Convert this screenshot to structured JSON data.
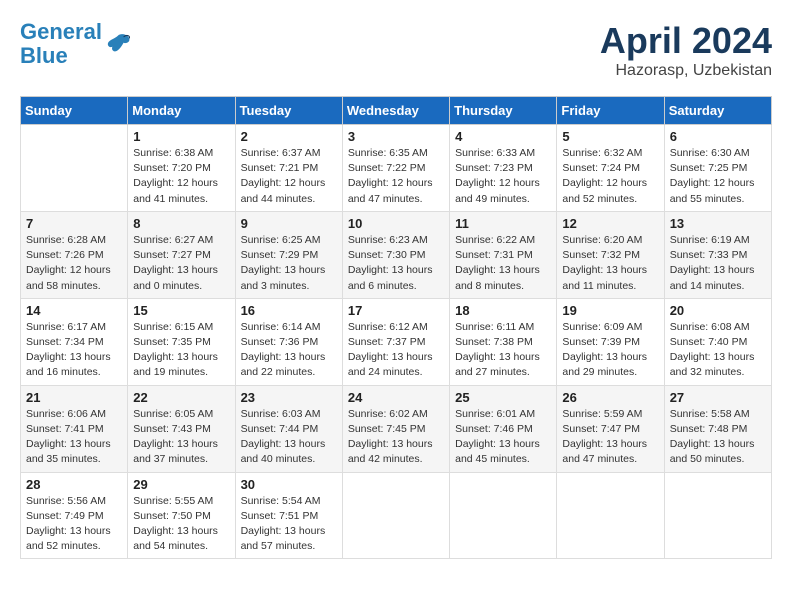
{
  "header": {
    "logo_line1": "General",
    "logo_line2": "Blue",
    "month": "April 2024",
    "location": "Hazorasp, Uzbekistan"
  },
  "days_of_week": [
    "Sunday",
    "Monday",
    "Tuesday",
    "Wednesday",
    "Thursday",
    "Friday",
    "Saturday"
  ],
  "weeks": [
    [
      {
        "day": "",
        "sunrise": "",
        "sunset": "",
        "daylight": ""
      },
      {
        "day": "1",
        "sunrise": "Sunrise: 6:38 AM",
        "sunset": "Sunset: 7:20 PM",
        "daylight": "Daylight: 12 hours and 41 minutes."
      },
      {
        "day": "2",
        "sunrise": "Sunrise: 6:37 AM",
        "sunset": "Sunset: 7:21 PM",
        "daylight": "Daylight: 12 hours and 44 minutes."
      },
      {
        "day": "3",
        "sunrise": "Sunrise: 6:35 AM",
        "sunset": "Sunset: 7:22 PM",
        "daylight": "Daylight: 12 hours and 47 minutes."
      },
      {
        "day": "4",
        "sunrise": "Sunrise: 6:33 AM",
        "sunset": "Sunset: 7:23 PM",
        "daylight": "Daylight: 12 hours and 49 minutes."
      },
      {
        "day": "5",
        "sunrise": "Sunrise: 6:32 AM",
        "sunset": "Sunset: 7:24 PM",
        "daylight": "Daylight: 12 hours and 52 minutes."
      },
      {
        "day": "6",
        "sunrise": "Sunrise: 6:30 AM",
        "sunset": "Sunset: 7:25 PM",
        "daylight": "Daylight: 12 hours and 55 minutes."
      }
    ],
    [
      {
        "day": "7",
        "sunrise": "Sunrise: 6:28 AM",
        "sunset": "Sunset: 7:26 PM",
        "daylight": "Daylight: 12 hours and 58 minutes."
      },
      {
        "day": "8",
        "sunrise": "Sunrise: 6:27 AM",
        "sunset": "Sunset: 7:27 PM",
        "daylight": "Daylight: 13 hours and 0 minutes."
      },
      {
        "day": "9",
        "sunrise": "Sunrise: 6:25 AM",
        "sunset": "Sunset: 7:29 PM",
        "daylight": "Daylight: 13 hours and 3 minutes."
      },
      {
        "day": "10",
        "sunrise": "Sunrise: 6:23 AM",
        "sunset": "Sunset: 7:30 PM",
        "daylight": "Daylight: 13 hours and 6 minutes."
      },
      {
        "day": "11",
        "sunrise": "Sunrise: 6:22 AM",
        "sunset": "Sunset: 7:31 PM",
        "daylight": "Daylight: 13 hours and 8 minutes."
      },
      {
        "day": "12",
        "sunrise": "Sunrise: 6:20 AM",
        "sunset": "Sunset: 7:32 PM",
        "daylight": "Daylight: 13 hours and 11 minutes."
      },
      {
        "day": "13",
        "sunrise": "Sunrise: 6:19 AM",
        "sunset": "Sunset: 7:33 PM",
        "daylight": "Daylight: 13 hours and 14 minutes."
      }
    ],
    [
      {
        "day": "14",
        "sunrise": "Sunrise: 6:17 AM",
        "sunset": "Sunset: 7:34 PM",
        "daylight": "Daylight: 13 hours and 16 minutes."
      },
      {
        "day": "15",
        "sunrise": "Sunrise: 6:15 AM",
        "sunset": "Sunset: 7:35 PM",
        "daylight": "Daylight: 13 hours and 19 minutes."
      },
      {
        "day": "16",
        "sunrise": "Sunrise: 6:14 AM",
        "sunset": "Sunset: 7:36 PM",
        "daylight": "Daylight: 13 hours and 22 minutes."
      },
      {
        "day": "17",
        "sunrise": "Sunrise: 6:12 AM",
        "sunset": "Sunset: 7:37 PM",
        "daylight": "Daylight: 13 hours and 24 minutes."
      },
      {
        "day": "18",
        "sunrise": "Sunrise: 6:11 AM",
        "sunset": "Sunset: 7:38 PM",
        "daylight": "Daylight: 13 hours and 27 minutes."
      },
      {
        "day": "19",
        "sunrise": "Sunrise: 6:09 AM",
        "sunset": "Sunset: 7:39 PM",
        "daylight": "Daylight: 13 hours and 29 minutes."
      },
      {
        "day": "20",
        "sunrise": "Sunrise: 6:08 AM",
        "sunset": "Sunset: 7:40 PM",
        "daylight": "Daylight: 13 hours and 32 minutes."
      }
    ],
    [
      {
        "day": "21",
        "sunrise": "Sunrise: 6:06 AM",
        "sunset": "Sunset: 7:41 PM",
        "daylight": "Daylight: 13 hours and 35 minutes."
      },
      {
        "day": "22",
        "sunrise": "Sunrise: 6:05 AM",
        "sunset": "Sunset: 7:43 PM",
        "daylight": "Daylight: 13 hours and 37 minutes."
      },
      {
        "day": "23",
        "sunrise": "Sunrise: 6:03 AM",
        "sunset": "Sunset: 7:44 PM",
        "daylight": "Daylight: 13 hours and 40 minutes."
      },
      {
        "day": "24",
        "sunrise": "Sunrise: 6:02 AM",
        "sunset": "Sunset: 7:45 PM",
        "daylight": "Daylight: 13 hours and 42 minutes."
      },
      {
        "day": "25",
        "sunrise": "Sunrise: 6:01 AM",
        "sunset": "Sunset: 7:46 PM",
        "daylight": "Daylight: 13 hours and 45 minutes."
      },
      {
        "day": "26",
        "sunrise": "Sunrise: 5:59 AM",
        "sunset": "Sunset: 7:47 PM",
        "daylight": "Daylight: 13 hours and 47 minutes."
      },
      {
        "day": "27",
        "sunrise": "Sunrise: 5:58 AM",
        "sunset": "Sunset: 7:48 PM",
        "daylight": "Daylight: 13 hours and 50 minutes."
      }
    ],
    [
      {
        "day": "28",
        "sunrise": "Sunrise: 5:56 AM",
        "sunset": "Sunset: 7:49 PM",
        "daylight": "Daylight: 13 hours and 52 minutes."
      },
      {
        "day": "29",
        "sunrise": "Sunrise: 5:55 AM",
        "sunset": "Sunset: 7:50 PM",
        "daylight": "Daylight: 13 hours and 54 minutes."
      },
      {
        "day": "30",
        "sunrise": "Sunrise: 5:54 AM",
        "sunset": "Sunset: 7:51 PM",
        "daylight": "Daylight: 13 hours and 57 minutes."
      },
      {
        "day": "",
        "sunrise": "",
        "sunset": "",
        "daylight": ""
      },
      {
        "day": "",
        "sunrise": "",
        "sunset": "",
        "daylight": ""
      },
      {
        "day": "",
        "sunrise": "",
        "sunset": "",
        "daylight": ""
      },
      {
        "day": "",
        "sunrise": "",
        "sunset": "",
        "daylight": ""
      }
    ]
  ]
}
